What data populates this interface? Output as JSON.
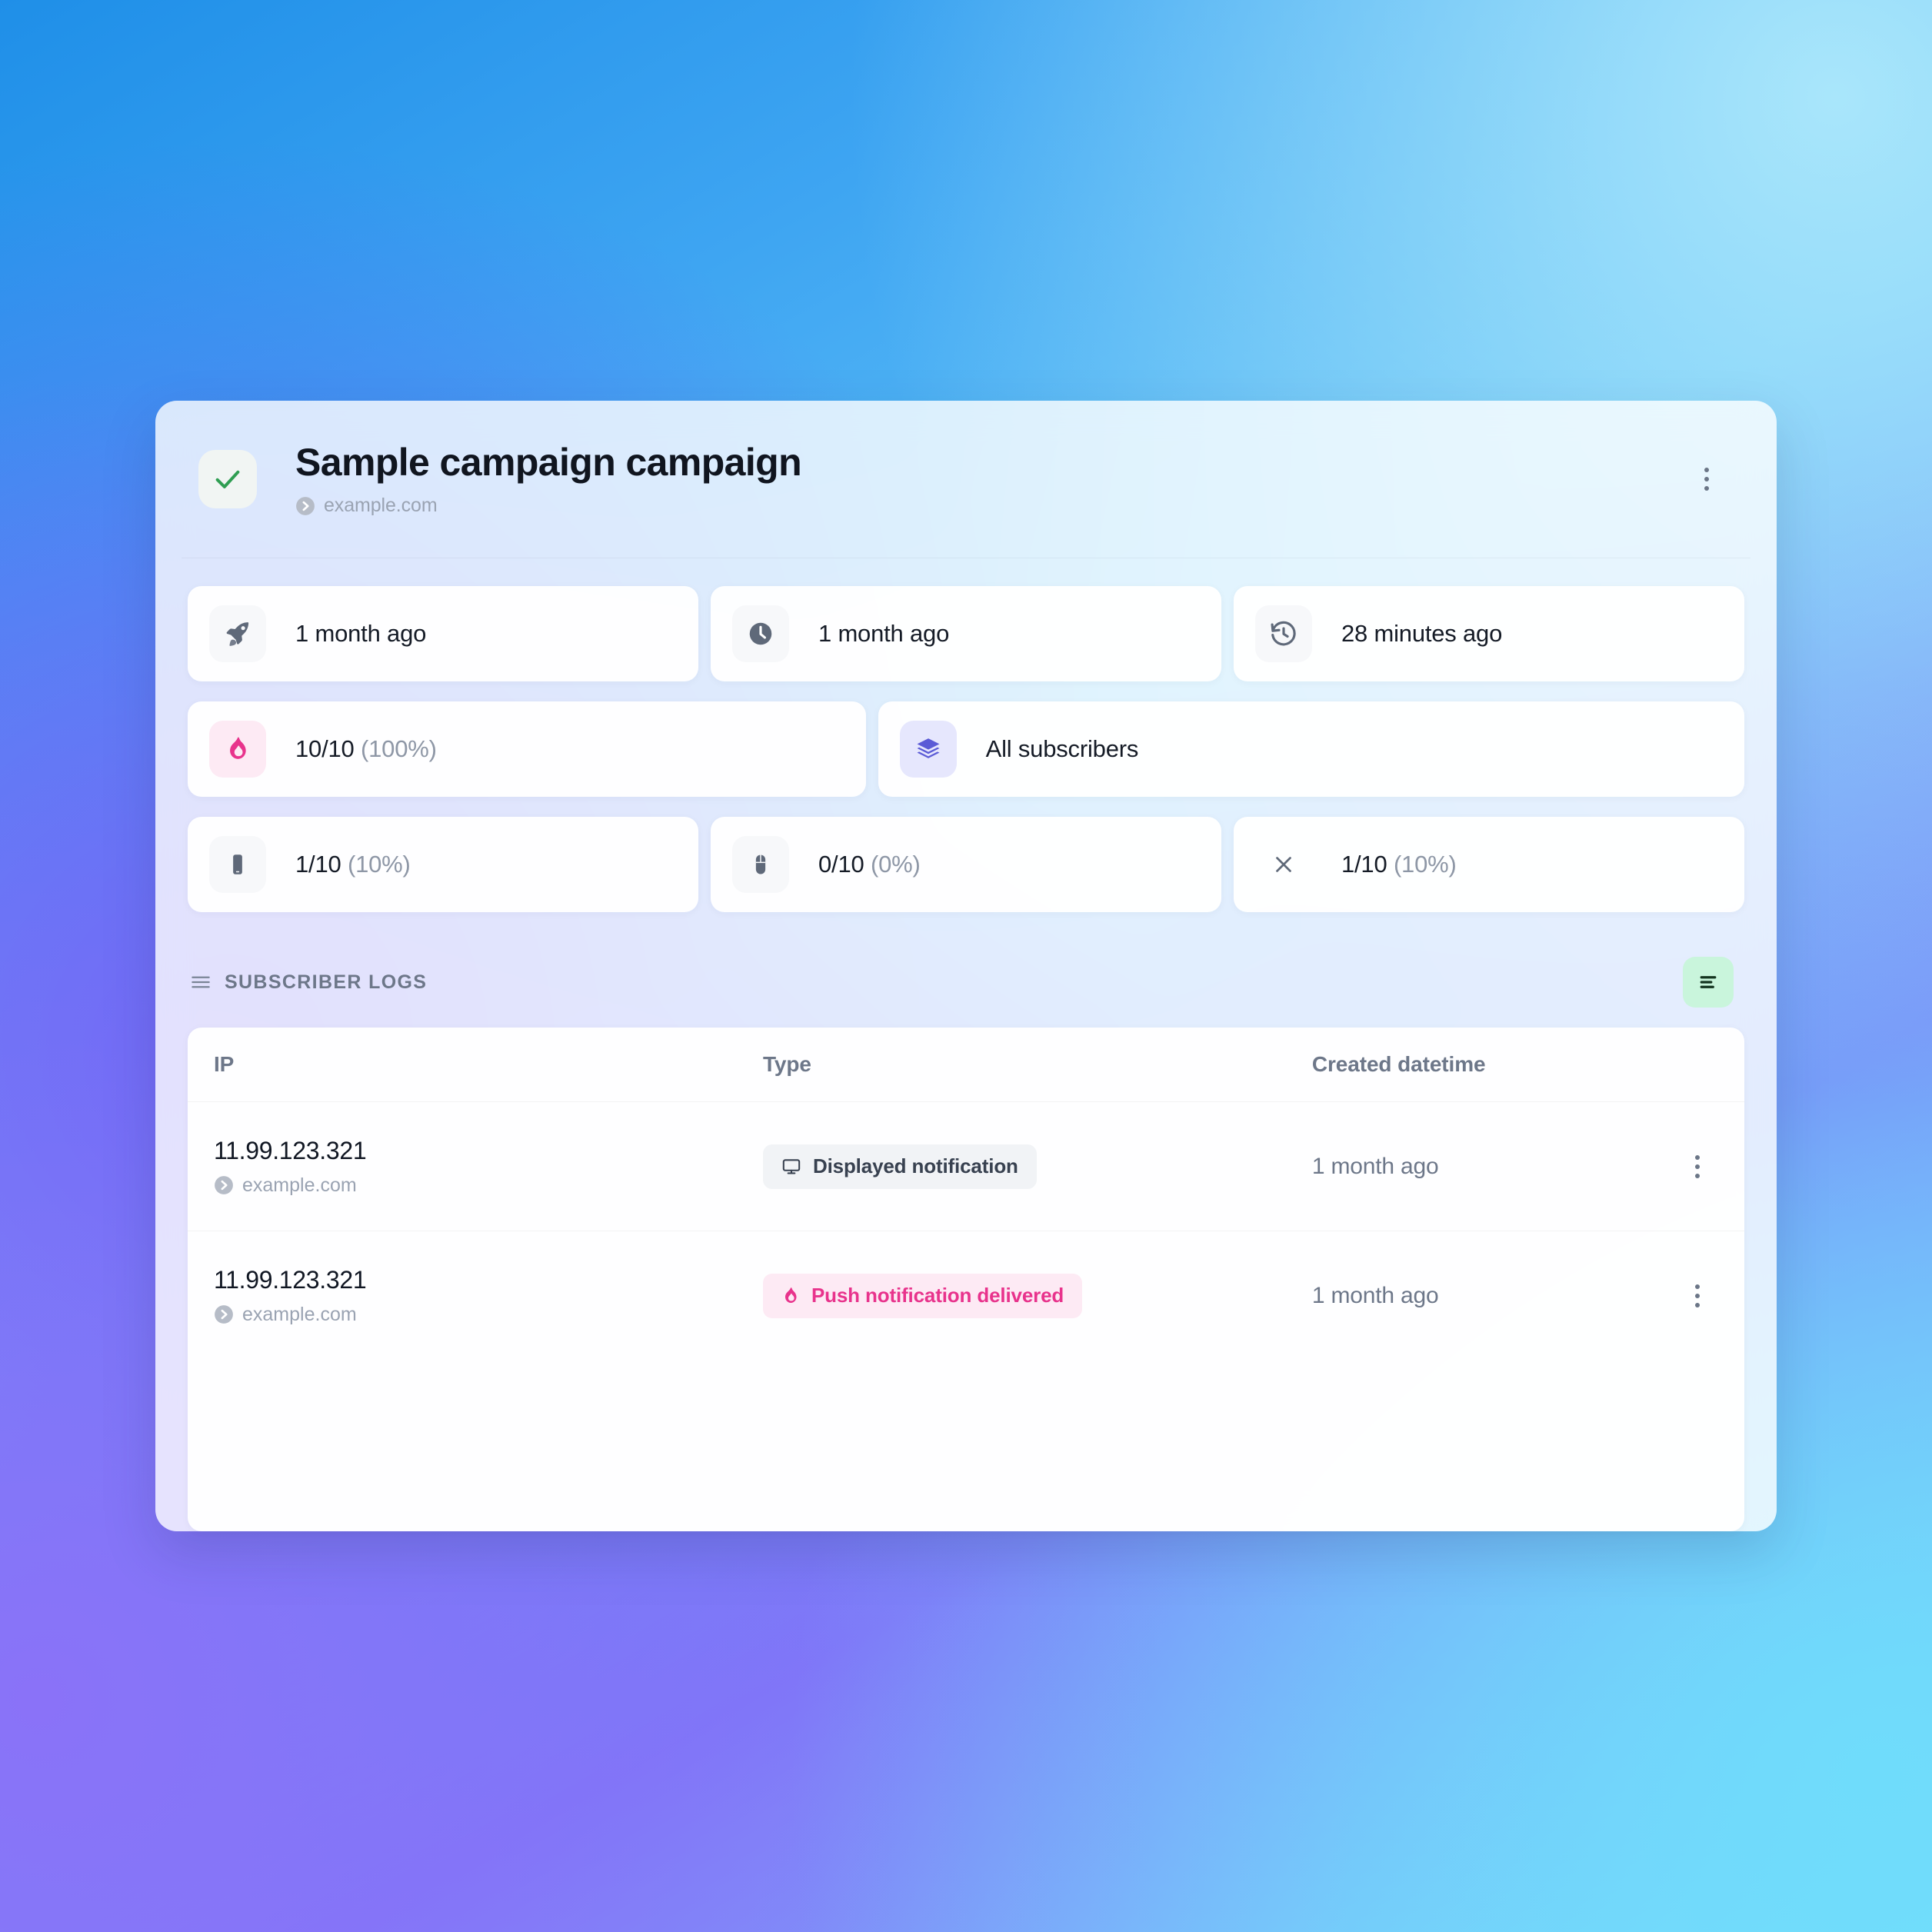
{
  "header": {
    "status_icon": "check-icon",
    "title": "Sample campaign campaign",
    "domain": "example.com",
    "menu_icon": "kebab-menu-icon"
  },
  "stats": {
    "row1": [
      {
        "icon": "rocket-icon",
        "value": "1 month ago"
      },
      {
        "icon": "clock-icon",
        "value": "1 month ago"
      },
      {
        "icon": "history-icon",
        "value": "28 minutes ago"
      }
    ],
    "row2": [
      {
        "icon": "flame-icon",
        "value": "10/10",
        "sub": "(100%)"
      },
      {
        "icon": "layers-icon",
        "value": "All subscribers",
        "sub": ""
      }
    ],
    "row3": [
      {
        "icon": "mobile-icon",
        "value": "1/10",
        "sub": "(10%)"
      },
      {
        "icon": "mouse-icon",
        "value": "0/10",
        "sub": "(0%)"
      },
      {
        "icon": "close-icon",
        "value": "1/10",
        "sub": "(10%)"
      }
    ]
  },
  "logs": {
    "section_icon": "list-icon",
    "section_title": "SUBSCRIBER LOGS",
    "action_icon": "align-list-icon",
    "columns": [
      "IP",
      "Type",
      "Created datetime"
    ],
    "rows": [
      {
        "ip": "11.99.123.321",
        "domain": "example.com",
        "type_label": "Displayed notification",
        "type_icon": "monitor-icon",
        "type_style": "neutral",
        "created": "1 month ago",
        "menu_icon": "kebab-menu-icon"
      },
      {
        "ip": "11.99.123.321",
        "domain": "example.com",
        "type_label": "Push notification delivered",
        "type_icon": "flame-icon",
        "type_style": "pink",
        "created": "1 month ago",
        "menu_icon": "kebab-menu-icon"
      }
    ]
  },
  "colors": {
    "success_green": "#2f9e52",
    "accent_pink": "#e8338c",
    "accent_indigo": "#5b5bd6",
    "mint_button": "#c9f5dc",
    "mint_button_icon": "#13341f",
    "slate_text": "#6d7789"
  }
}
